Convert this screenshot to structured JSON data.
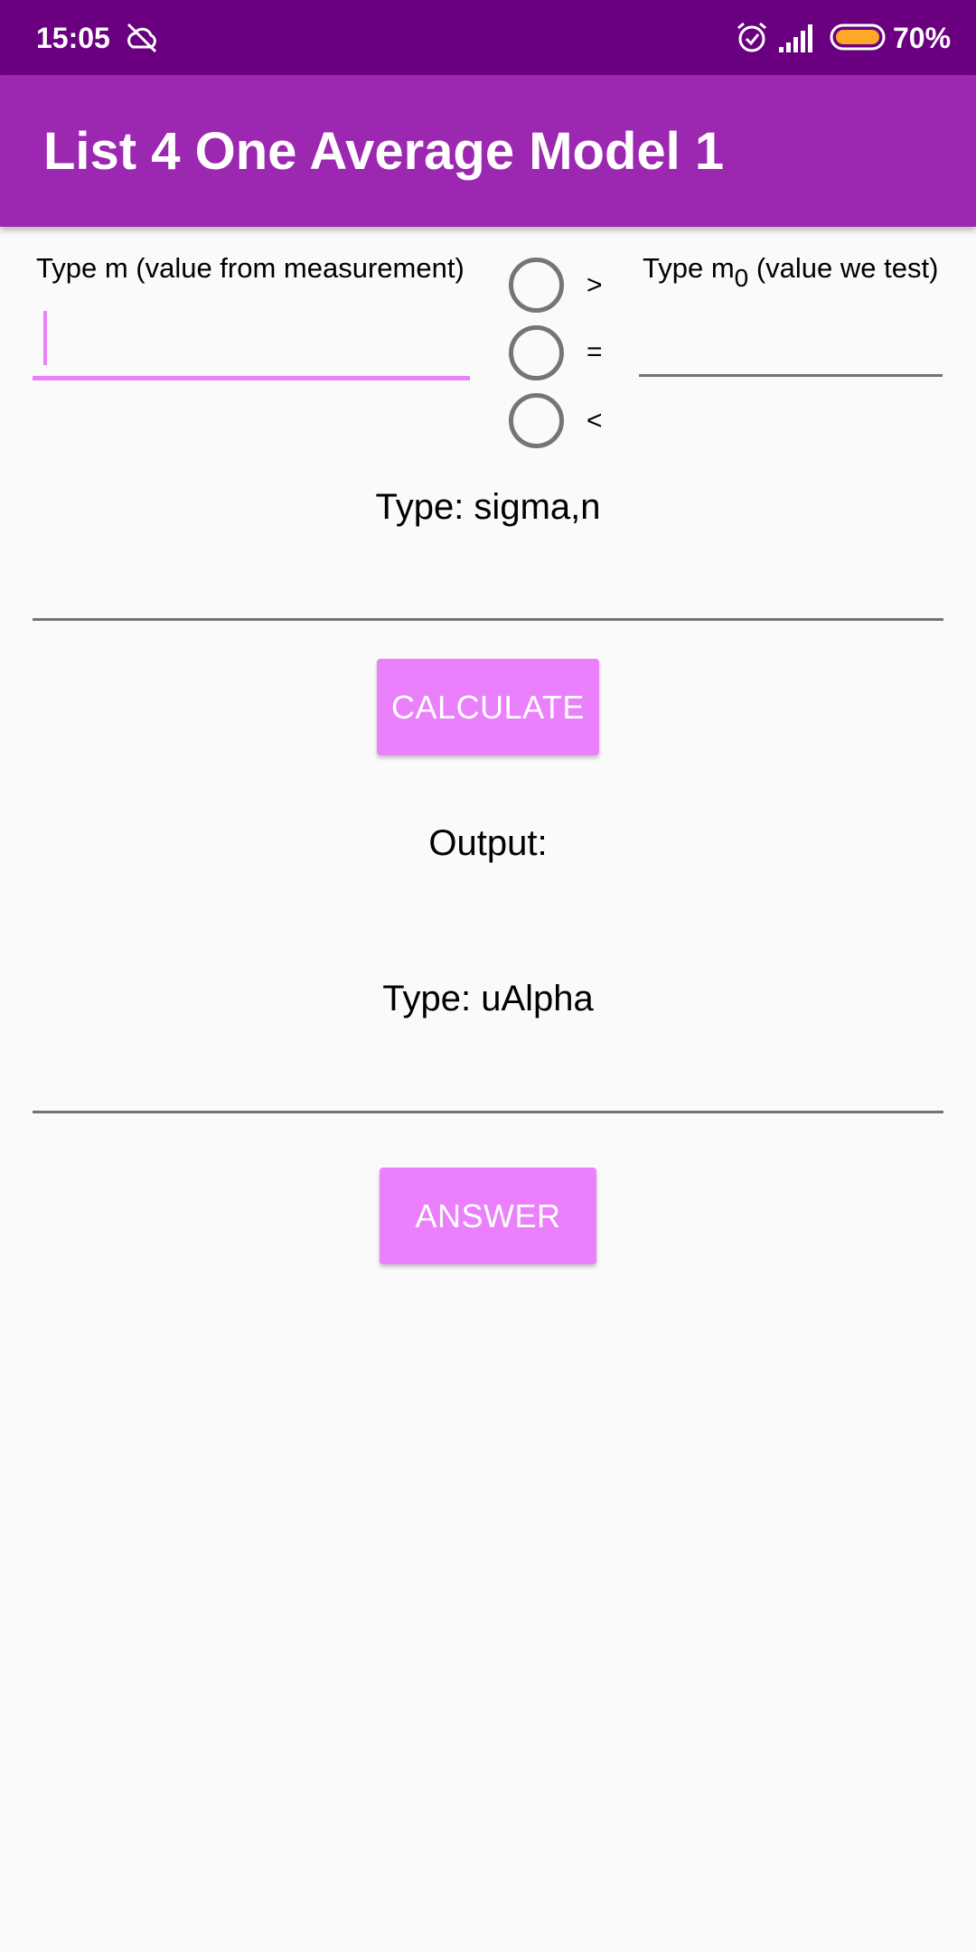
{
  "status_bar": {
    "time": "15:05",
    "battery_percent": "70%",
    "battery_level": 0.7,
    "icons": [
      "cloud-off-icon",
      "alarm-icon",
      "signal-icon",
      "battery-icon"
    ]
  },
  "app_bar": {
    "title": "List 4 One Average Model 1"
  },
  "form": {
    "m_label": "Type m (value from measurement)",
    "m_value": "",
    "m0_label_prefix": "Type m",
    "m0_label_sub": "0",
    "m0_label_suffix": " (value we test)",
    "m0_value": "",
    "operators": [
      {
        "symbol": ">",
        "checked": false
      },
      {
        "symbol": "=",
        "checked": false
      },
      {
        "symbol": "<",
        "checked": false
      }
    ],
    "sigma_label": "Type: sigma,n",
    "sigma_value": "",
    "calculate_label": "CALCULATE",
    "output_label": "Output:",
    "ualpha_label": "Type: uAlpha",
    "ualpha_value": "",
    "answer_label": "ANSWER"
  },
  "colors": {
    "status_bar": "#6a0080",
    "app_bar": "#9c27b0",
    "accent": "#ea80fc",
    "background": "#fafafa",
    "battery_fill": "#ffa726"
  }
}
